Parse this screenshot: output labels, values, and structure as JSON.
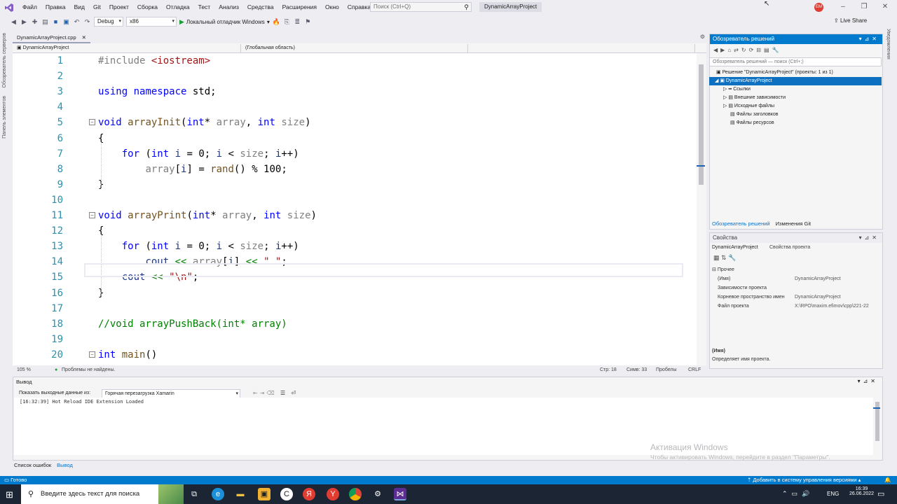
{
  "menubar": {
    "items": [
      "Файл",
      "Правка",
      "Вид",
      "Git",
      "Проект",
      "Сборка",
      "Отладка",
      "Тест",
      "Анализ",
      "Средства",
      "Расширения",
      "Окно",
      "Справка"
    ],
    "search_placeholder": "Поиск (Ctrl+Q)",
    "project_title": "DynamicArrayProject",
    "avatar_initials": "EM"
  },
  "toolbar": {
    "config": "Debug",
    "platform": "x86",
    "debugger_label": "Локальный отладчик Windows",
    "live_share": "Live Share"
  },
  "left_strip": [
    "Обозреватель серверов",
    "Панель элементов"
  ],
  "right_strip": "Уведомления",
  "document": {
    "tab_name": "DynamicArrayProject.cpp",
    "nav_project": "DynamicArrayProject",
    "nav_scope": "(Глобальная область)",
    "nav_member": ""
  },
  "code_lines": [
    {
      "n": "1",
      "parts": [
        [
          "pp",
          "#include "
        ],
        [
          "inc",
          "<iostream>"
        ]
      ]
    },
    {
      "n": "2",
      "parts": []
    },
    {
      "n": "3",
      "parts": [
        [
          "kw",
          "using"
        ],
        [
          "tx",
          " "
        ],
        [
          "kw",
          "namespace"
        ],
        [
          "tx",
          " std;"
        ]
      ]
    },
    {
      "n": "4",
      "parts": []
    },
    {
      "n": "5",
      "fold": true,
      "parts": [
        [
          "kw",
          "void"
        ],
        [
          "tx",
          " "
        ],
        [
          "fn",
          "arrayInit"
        ],
        [
          "tx",
          "("
        ],
        [
          "kw",
          "int"
        ],
        [
          "tx",
          "* "
        ],
        [
          "pr",
          "array"
        ],
        [
          "tx",
          ", "
        ],
        [
          "kw",
          "int"
        ],
        [
          "tx",
          " "
        ],
        [
          "pr",
          "size"
        ],
        [
          "tx",
          ")"
        ]
      ]
    },
    {
      "n": "6",
      "parts": [
        [
          "tx",
          "{"
        ]
      ]
    },
    {
      "n": "7",
      "parts": [
        [
          "tx",
          "    "
        ],
        [
          "kw",
          "for"
        ],
        [
          "tx",
          " ("
        ],
        [
          "kw",
          "int"
        ],
        [
          "tx",
          " "
        ],
        [
          "var",
          "i"
        ],
        [
          "tx",
          " = 0; "
        ],
        [
          "var",
          "i"
        ],
        [
          "tx",
          " < "
        ],
        [
          "pr",
          "size"
        ],
        [
          "tx",
          "; "
        ],
        [
          "var",
          "i"
        ],
        [
          "tx",
          "++)"
        ]
      ]
    },
    {
      "n": "8",
      "parts": [
        [
          "tx",
          "        "
        ],
        [
          "pr",
          "array"
        ],
        [
          "tx",
          "["
        ],
        [
          "var",
          "i"
        ],
        [
          "tx",
          "] = "
        ],
        [
          "fn",
          "rand"
        ],
        [
          "tx",
          "() % 100;"
        ]
      ]
    },
    {
      "n": "9",
      "parts": [
        [
          "tx",
          "}"
        ]
      ]
    },
    {
      "n": "10",
      "parts": []
    },
    {
      "n": "11",
      "fold": true,
      "parts": [
        [
          "kw",
          "void"
        ],
        [
          "tx",
          " "
        ],
        [
          "fn",
          "arrayPrint"
        ],
        [
          "tx",
          "("
        ],
        [
          "kw",
          "int"
        ],
        [
          "tx",
          "* "
        ],
        [
          "pr",
          "array"
        ],
        [
          "tx",
          ", "
        ],
        [
          "kw",
          "int"
        ],
        [
          "tx",
          " "
        ],
        [
          "pr",
          "size"
        ],
        [
          "tx",
          ")"
        ]
      ]
    },
    {
      "n": "12",
      "parts": [
        [
          "tx",
          "{"
        ]
      ]
    },
    {
      "n": "13",
      "parts": [
        [
          "tx",
          "    "
        ],
        [
          "kw",
          "for"
        ],
        [
          "tx",
          " ("
        ],
        [
          "kw",
          "int"
        ],
        [
          "tx",
          " "
        ],
        [
          "var",
          "i"
        ],
        [
          "tx",
          " = 0; "
        ],
        [
          "var",
          "i"
        ],
        [
          "tx",
          " < "
        ],
        [
          "pr",
          "size"
        ],
        [
          "tx",
          "; "
        ],
        [
          "var",
          "i"
        ],
        [
          "tx",
          "++)"
        ]
      ]
    },
    {
      "n": "14",
      "parts": [
        [
          "tx",
          "        "
        ],
        [
          "var",
          "cout"
        ],
        [
          "tx",
          " "
        ],
        [
          "cm",
          "<<"
        ],
        [
          "tx",
          " "
        ],
        [
          "pr",
          "array"
        ],
        [
          "tx",
          "["
        ],
        [
          "var",
          "i"
        ],
        [
          "tx",
          "] "
        ],
        [
          "cm",
          "<<"
        ],
        [
          "tx",
          " "
        ],
        [
          "st",
          "\" \""
        ],
        [
          "tx",
          ";"
        ]
      ]
    },
    {
      "n": "15",
      "parts": [
        [
          "tx",
          "    "
        ],
        [
          "var",
          "cout"
        ],
        [
          "tx",
          " "
        ],
        [
          "cm",
          "<<"
        ],
        [
          "tx",
          " "
        ],
        [
          "st",
          "\"\\n\""
        ],
        [
          "tx",
          ";"
        ]
      ]
    },
    {
      "n": "16",
      "parts": [
        [
          "tx",
          "}"
        ]
      ]
    },
    {
      "n": "17",
      "parts": []
    },
    {
      "n": "18",
      "parts": [
        [
          "cm",
          "//void arrayPushBack(int* array)"
        ]
      ]
    },
    {
      "n": "19",
      "parts": []
    },
    {
      "n": "20",
      "fold": true,
      "parts": [
        [
          "kw",
          "int"
        ],
        [
          "tx",
          " "
        ],
        [
          "fn",
          "main"
        ],
        [
          "tx",
          "()"
        ]
      ]
    }
  ],
  "editor_status": {
    "zoom": "105 %",
    "problems": "Проблемы не найдены.",
    "line": "Стр: 18",
    "col": "Симв: 33",
    "ws": "Пробелы",
    "eol": "CRLF"
  },
  "solution_explorer": {
    "title": "Обозреватель решений",
    "search_placeholder": "Обозреватель решений — поиск (Ctrl+;)",
    "solution": "Решение \"DynamicArrayProject\" (проекты: 1 из 1)",
    "project": "DynamicArrayProject",
    "nodes": [
      "Ссылки",
      "Внешние зависимости",
      "Исходные файлы",
      "Файлы заголовков",
      "Файлы ресурсов"
    ],
    "tab_active": "Обозреватель решений",
    "tab_git": "Изменения Git"
  },
  "properties": {
    "title": "Свойства",
    "object": "DynamicArrayProject",
    "object_type": "Свойства проекта",
    "category": "Прочее",
    "rows": [
      {
        "k": "(Имя)",
        "v": "DynamicArrayProject"
      },
      {
        "k": "Зависимости проекта",
        "v": ""
      },
      {
        "k": "Корневое пространство имен",
        "v": "DynamicArrayProject"
      },
      {
        "k": "Файл проекта",
        "v": "X:\\RPO\\maxim.efimov\\cpp\\221-22"
      }
    ],
    "desc_title": "(Имя)",
    "desc_text": "Определяет имя проекта."
  },
  "output": {
    "title": "Вывод",
    "source_label": "Показать выходные данные из:",
    "source_value": "Горячая перезагрузка Xamarin",
    "log": "[16:32:39]  Hot Reload IDE Extension Loaded",
    "tab_errors": "Список ошибок",
    "tab_output": "Вывод"
  },
  "statusbar": {
    "ready": "Готово",
    "vcs": "Добавить в систему управления версиями"
  },
  "activation": {
    "title": "Активация Windows",
    "text": "Чтобы активировать Windows, перейдите в раздел \"Параметры\"."
  },
  "taskbar": {
    "search_placeholder": "Введите здесь текст для поиска",
    "lang": "ENG",
    "time": "16:39",
    "date": "26.06.2022"
  },
  "colors": {
    "accent": "#007acc",
    "selection": "#0e70c0",
    "editor_bg": "#ffffff"
  }
}
